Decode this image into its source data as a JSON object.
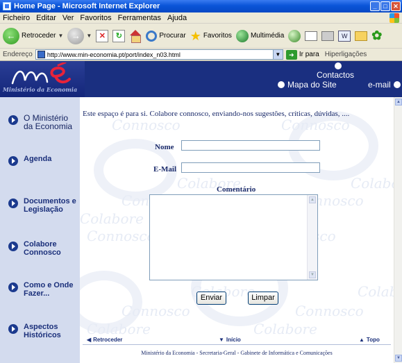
{
  "window": {
    "title": "Home Page - Microsoft Internet Explorer",
    "buttons": [
      "minimize-icon",
      "maximize-icon",
      "close-icon"
    ]
  },
  "menu": [
    "Ficheiro",
    "Editar",
    "Ver",
    "Favoritos",
    "Ferramentas",
    "Ajuda"
  ],
  "toolbar": {
    "back_label": "Retroceder",
    "search_label": "Procurar",
    "favorites_label": "Favoritos",
    "media_label": "Multimédia"
  },
  "address": {
    "label": "Endereço",
    "url": "http://www.min-economia.pt/port/index_n03.html",
    "go_label": "Ir para",
    "links_label": "Hiperligações"
  },
  "header": {
    "logo_text": "Ministério da Economia",
    "contactos": "Contactos",
    "mapa": "Mapa do Site",
    "email": "e-mail"
  },
  "sidebar": {
    "items": [
      {
        "label": "O Ministério da Economia"
      },
      {
        "label": "Agenda"
      },
      {
        "label": "Documentos e Legislação"
      },
      {
        "label": "Colabore Connosco"
      },
      {
        "label": "Como e Onde Fazer..."
      },
      {
        "label": "Aspectos Históricos"
      }
    ]
  },
  "form": {
    "intro": "Este espaço é para si. Colabore connosco, enviando-nos sugestões, críticas, dúvidas, ....",
    "name_label": "Nome",
    "name_value": "",
    "email_label": "E-Mail",
    "email_value": "",
    "comment_label": "Comentário",
    "comment_value": "",
    "submit_label": "Enviar",
    "reset_label": "Limpar"
  },
  "footer_nav": {
    "back": "Retroceder",
    "home": "Início",
    "top": "Topo"
  },
  "footer": "Ministério da Economia - Secretaria-Geral - Gabinete de Informática e Comunicações",
  "watermark": [
    "Colabore",
    "Connosco"
  ],
  "colors": {
    "header_bg": "#1a2f80",
    "sidebar_bg": "#d3dbee",
    "link": "#1a2f7a",
    "logo_accent": "#e8233a"
  }
}
